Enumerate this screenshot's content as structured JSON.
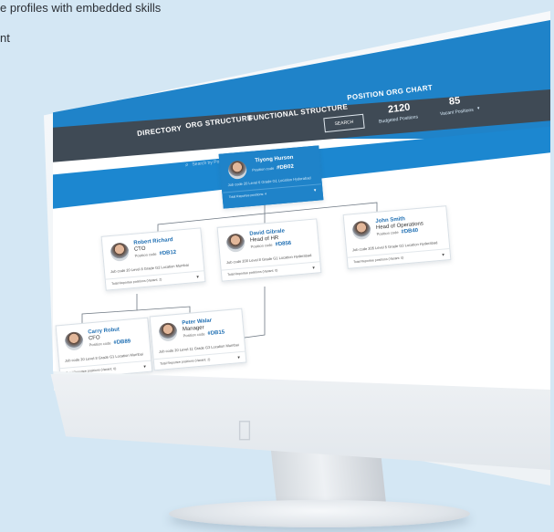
{
  "caption": {
    "line1": "e profiles with embedded skills",
    "line2": "nt"
  },
  "nav": {
    "directory": "DIRECTORY",
    "org_structure": "ORG STRUCTURE",
    "functional_structure": "FUNCTIONAL STRUCTURE",
    "position_org_chart": "POSITION ORG CHART",
    "search_button": "SEARCH",
    "search_placeholder": "Search by Position ID",
    "budgeted_value": "2120",
    "budgeted_label": "Budgeted Positions",
    "vacant_value": "85",
    "vacant_label": "Vacant Positions"
  },
  "cards": {
    "top": {
      "name": "Tiyong Hurson",
      "pos_label": "Position code",
      "pos_code": "#DB02",
      "meta": "Job code 20   Level 6   Grade G1   Location Hyderabad",
      "footer": "Total Reportee positions: 4"
    },
    "robert": {
      "name": "Robert Richard",
      "title": "CTO",
      "pos_label": "Position code",
      "pos_code": "#DB12",
      "meta": "Job code 20   Level 8   Grade G2   Location Mumbai",
      "footer": "Total Reportee positions (Vacant: 2)"
    },
    "david": {
      "name": "David Gibrale",
      "title": "Head of HR",
      "pos_label": "Position code",
      "pos_code": "#D856",
      "meta": "Job code 200   Level 8   Grade G1   Location Hyderabad",
      "footer": "Total Reportee positions (Vacant: 0)"
    },
    "john": {
      "name": "John Smith",
      "title": "Head of Operations",
      "pos_label": "Position code",
      "pos_code": "#DB40",
      "meta": "Job code 205   Level 5   Grade G3   Location Hyderabad",
      "footer": "Total Reportee positions (Vacant: 0)"
    },
    "carry": {
      "name": "Carry Robut",
      "title": "CFO",
      "pos_label": "Position code",
      "pos_code": "#DB89",
      "meta": "Job code 20   Level 8   Grade G1   Location Mumbai",
      "footer": "Total Reportee positions (Vacant: 0)"
    },
    "peter": {
      "name": "Peter Walar",
      "title": "Manager",
      "pos_label": "Position code",
      "pos_code": "#DB15",
      "meta": "Job code 20   Level 11   Grade G3   Location Mumbai",
      "footer": "Total Reportee positions (Vacant: 2)"
    }
  },
  "colors": {
    "primary_blue": "#1f83c9",
    "nav_dark": "#3f4a55",
    "background": "#d4e7f4"
  },
  "icons": {
    "search": "search-icon",
    "caret": "chevron-down-icon",
    "apple": "apple-logo-icon"
  }
}
